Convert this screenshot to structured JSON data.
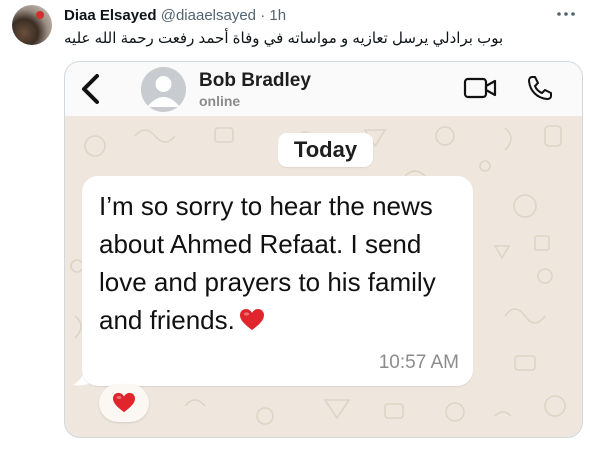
{
  "tweet": {
    "author_name": "Diaa Elsayed",
    "author_handle": "@diaaelsayed",
    "separator": "·",
    "time": "1h",
    "text": "بوب برادلي يرسل تعازيه و مواساته في وفاة أحمد رفعت رحمة الله عليه",
    "more_icon": "more-dots-icon"
  },
  "chat": {
    "contact_name": "Bob Bradley",
    "contact_status": "online",
    "date_label": "Today",
    "message_text": "I’m so sorry to hear the news about Ahmed Refaat. I send love and prayers to his family and friends.",
    "message_emoji": "red-heart-icon",
    "message_time": "10:57 AM",
    "reaction": "red-heart-icon",
    "icons": {
      "back": "chevron-left-icon",
      "avatar": "default-avatar-icon",
      "video": "video-call-icon",
      "voice": "phone-icon"
    }
  },
  "colors": {
    "chat_background": "#efe7dd",
    "bubble": "#ffffff",
    "heart": "#e0252c",
    "tweet_text": "#0f1419",
    "secondary_text": "#536471"
  }
}
